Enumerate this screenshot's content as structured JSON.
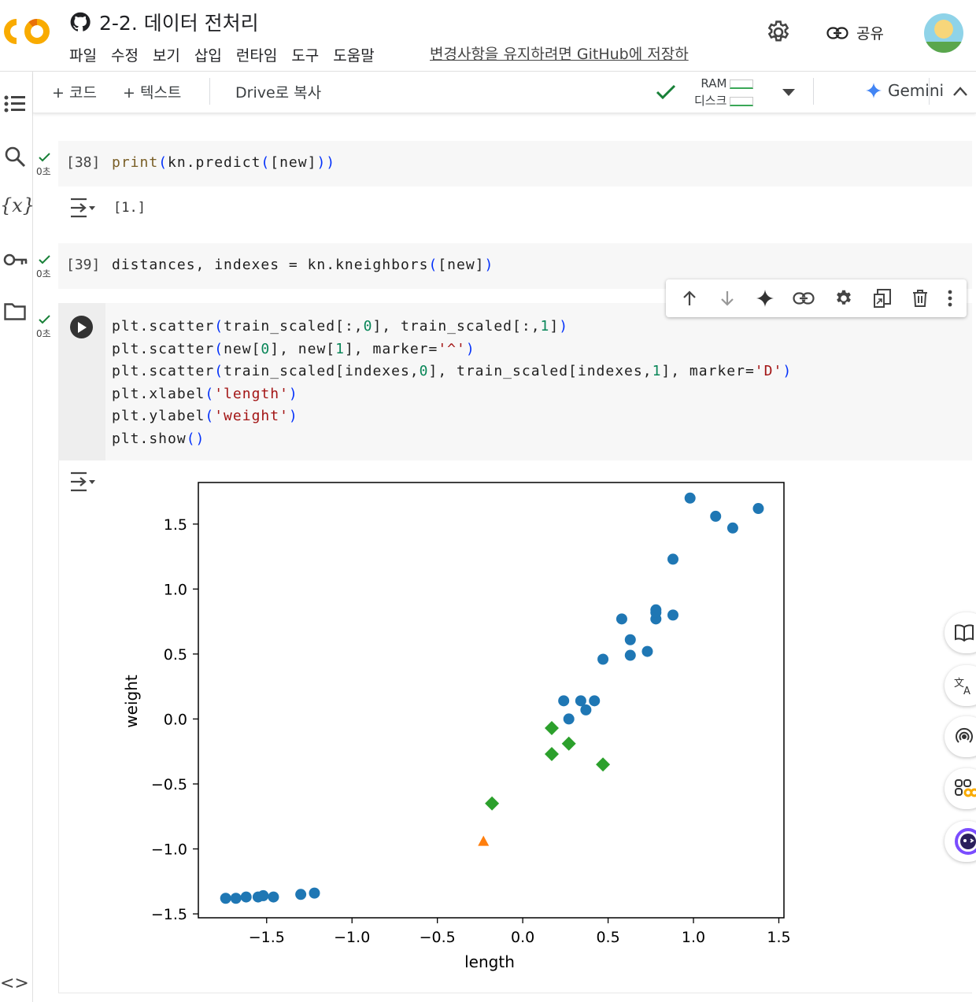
{
  "header": {
    "title": "2-2. 데이터 전처리",
    "menu": [
      "파일",
      "수정",
      "보기",
      "삽입",
      "런타임",
      "도구",
      "도움말"
    ],
    "save_note": "변경사항을 유지하려면 GitHub에 저장하",
    "share_label": "공유"
  },
  "toolbar": {
    "add_code": "+ 코드",
    "add_text": "+ 텍스트",
    "copy_drive": "Drive로 복사",
    "ram_label": "RAM",
    "disk_label": "디스크",
    "gemini_label": "Gemini"
  },
  "cells": [
    {
      "count": "[38]",
      "status": "0초",
      "code": "print(kn.predict([new]))",
      "output": "[1.]"
    },
    {
      "count": "[39]",
      "status": "0초",
      "code": "distances, indexes = kn.kneighbors([new])"
    },
    {
      "status": "0초",
      "code_lines": [
        "plt.scatter(train_scaled[:,0], train_scaled[:,1])",
        "plt.scatter(new[0], new[1], marker='^')",
        "plt.scatter(train_scaled[indexes,0], train_scaled[indexes,1], marker='D')",
        "plt.xlabel('length')",
        "plt.ylabel('weight')",
        "plt.show()"
      ]
    }
  ],
  "chart_data": {
    "type": "scatter",
    "title": "",
    "xlabel": "length",
    "ylabel": "weight",
    "xlim": [
      -1.9,
      1.53
    ],
    "ylim": [
      -1.53,
      1.82
    ],
    "xticks": [
      -1.5,
      -1.0,
      -0.5,
      0.0,
      0.5,
      1.0,
      1.5
    ],
    "yticks": [
      -1.5,
      -1.0,
      -0.5,
      0.0,
      0.5,
      1.0,
      1.5
    ],
    "xtick_labels": [
      "−1.5",
      "−1.0",
      "−0.5",
      "0.0",
      "0.5",
      "1.0",
      "1.5"
    ],
    "ytick_labels": [
      "−1.5",
      "−1.0",
      "−0.5",
      "0.0",
      "0.5",
      "1.0",
      "1.5"
    ],
    "series": [
      {
        "marker": "circle",
        "color": "#1f77b4",
        "points": [
          [
            -1.74,
            -1.38
          ],
          [
            -1.68,
            -1.38
          ],
          [
            -1.62,
            -1.37
          ],
          [
            -1.55,
            -1.37
          ],
          [
            -1.52,
            -1.36
          ],
          [
            -1.46,
            -1.37
          ],
          [
            -1.3,
            -1.35
          ],
          [
            -1.22,
            -1.34
          ],
          [
            0.24,
            0.14
          ],
          [
            0.27,
            0.0
          ],
          [
            0.34,
            0.14
          ],
          [
            0.37,
            0.07
          ],
          [
            0.42,
            0.14
          ],
          [
            0.47,
            0.46
          ],
          [
            0.58,
            0.77
          ],
          [
            0.63,
            0.61
          ],
          [
            0.63,
            0.49
          ],
          [
            0.73,
            0.52
          ],
          [
            0.78,
            0.84
          ],
          [
            0.78,
            0.77
          ],
          [
            0.78,
            0.82
          ],
          [
            0.88,
            0.8
          ],
          [
            0.88,
            1.23
          ],
          [
            0.98,
            1.7
          ],
          [
            1.13,
            1.56
          ],
          [
            1.23,
            1.47
          ],
          [
            1.38,
            1.62
          ]
        ]
      },
      {
        "marker": "triangle",
        "color": "#ff7f0e",
        "points": [
          [
            -0.23,
            -0.94
          ]
        ]
      },
      {
        "marker": "diamond",
        "color": "#2ca02c",
        "points": [
          [
            -0.18,
            -0.65
          ],
          [
            0.17,
            -0.27
          ],
          [
            0.17,
            -0.07
          ],
          [
            0.27,
            -0.19
          ],
          [
            0.47,
            -0.35
          ]
        ]
      }
    ]
  }
}
